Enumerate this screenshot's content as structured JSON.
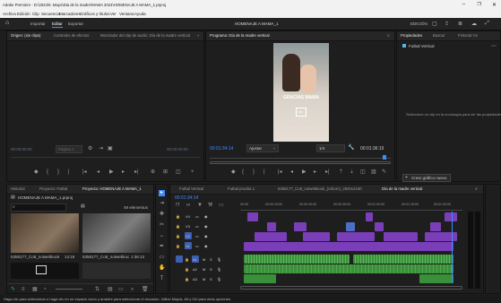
{
  "window": {
    "title": "Adobe Premiere - D:\\2024\\5. Mayo\\Dia de la madre\\MAMA 2024\\HOMENAJE A MAMA_1.prproj",
    "controls": [
      "–",
      "❐",
      "✕"
    ]
  },
  "menu": [
    "Archivo",
    "Edición",
    "Clip",
    "Secuencia",
    "Marcadores",
    "Gráficos y títulos",
    "Ver",
    "Ventana",
    "Ayuda"
  ],
  "topbar": {
    "tabs": [
      "Importar",
      "Editar",
      "Exportar"
    ],
    "active_tab": "Editar",
    "project_title": "HOMENAJE A MAMA_1",
    "workspace": "EDICIÓN"
  },
  "source_panel": {
    "tabs": [
      "Origen: (sin clips)",
      "Controles de efectos",
      "Mezclador del clip de audio: Día de la madre vertical"
    ],
    "timecode_left": "00:00:00:00",
    "page_label": "Página 1",
    "timecode_right": "00:00:00:00"
  },
  "program_panel": {
    "title": "Programa: Día de la madre vertical",
    "video_caption": "GRACIAS MAMÁ",
    "logo_text": "CBS",
    "timecode": "00:01:34:14",
    "fit": "Ajustar",
    "quality": "1/4",
    "duration": "00:01:36:19"
  },
  "properties_panel": {
    "tabs": [
      "Propiedades",
      "Buscar",
      "Fintonal V4"
    ],
    "item": "Futbal Vertical",
    "message": "Seleccione un clip en la cronología para ver las propiedades.",
    "button": "Crear gráfico nuevo"
  },
  "project_panel": {
    "tabs": [
      "Historial",
      "Proyecto: Futbal",
      "Proyecto: HOMENAJE A MAMA_1"
    ],
    "file": "HOMENAJE A MAMA_1.prproj",
    "count": "49 elementos",
    "thumbs": [
      {
        "name": "5358177_Co8_notwebkook_...",
        "duration": "14:19"
      },
      {
        "name": "5358177_Co8_notwebkook...",
        "duration": "1:36:13"
      }
    ]
  },
  "timeline": {
    "tabs": [
      "Futbal Vertical",
      "Futbal prueba 1",
      "5358177_Co8_notwebkook_(reborn)_2840x2160",
      "Día de la madre vertical"
    ],
    "active_tab": "Día de la madre vertical",
    "timecode": "00:01:34:14",
    "ruler": [
      "00:00",
      "00:00:15:00",
      "00:00:30:00",
      "00:00:45:00",
      "00:01:00:00",
      "00:01:15:00",
      "00:01:30:00"
    ],
    "video_tracks": [
      "V4",
      "V3",
      "V2",
      "V1"
    ],
    "audio_tracks": [
      "A1",
      "A2",
      "A3"
    ]
  },
  "status_bar": "Haga clic para seleccionar o haga clic en un espacio vacío y arrastre para seleccionar el recuadro. Utilice Mayús, Alt y Ctrl para otras opciones.",
  "colors": {
    "accent": "#3d8cff",
    "video_clip": "#7a3fb8",
    "audio_clip": "#3a8f3a",
    "playhead": "#3d8cff"
  }
}
